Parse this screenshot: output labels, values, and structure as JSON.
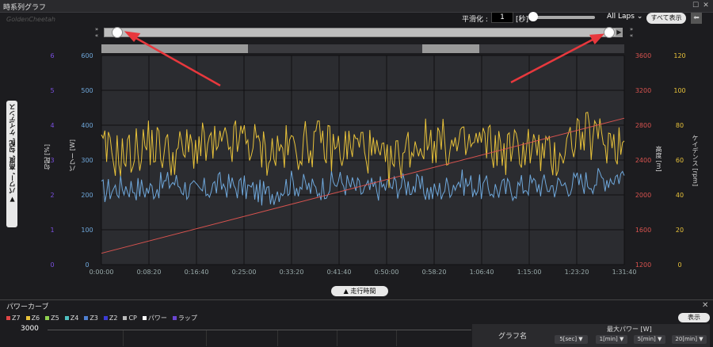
{
  "window": {
    "title": "時系列グラフ"
  },
  "controls": {
    "smoothing_label": "平滑化 :",
    "smoothing_value": "1",
    "smoothing_unit": "[秒]",
    "laps_select": "All Laps",
    "show_all_button": "すべて表示"
  },
  "side_tab": {
    "label": "▼ パワー, 高度, 勾配, ケイデンス"
  },
  "bottom_button": {
    "label": "▲ 走行時間"
  },
  "power_curve": {
    "title": "パワーカーブ",
    "legend": [
      {
        "label": "Z7",
        "color": "#e04545"
      },
      {
        "label": "Z6",
        "color": "#e8c23a"
      },
      {
        "label": "Z5",
        "color": "#8fd14f"
      },
      {
        "label": "Z4",
        "color": "#4fc0c0"
      },
      {
        "label": "Z3",
        "color": "#4f7fd1"
      },
      {
        "label": "Z2",
        "color": "#3b3bd6"
      },
      {
        "label": "CP",
        "color": "#bbbbbb"
      },
      {
        "label": "パワー",
        "color": "#ffffff"
      },
      {
        "label": "ラップ",
        "color": "#6a45d1"
      }
    ],
    "show_button": "表示",
    "y_value": "3000",
    "graph_name_header": "グラフ名",
    "max_power_header": "最大パワー [W]",
    "durations": [
      "5[sec] ▼",
      "1[min] ▼",
      "5[min] ▼",
      "20[min] ▼"
    ]
  },
  "chart_data": {
    "type": "line",
    "x_ticks": [
      "0:00:00",
      "0:08:20",
      "0:16:40",
      "0:25:00",
      "0:33:20",
      "0:41:40",
      "0:50:00",
      "0:58:20",
      "1:06:40",
      "1:15:00",
      "1:23:20",
      "1:31:40"
    ],
    "x_range_seconds": [
      0,
      5500
    ],
    "axes": {
      "slope": {
        "label": "勾配 [%]",
        "ticks": [
          "6",
          "5",
          "4",
          "3",
          "2",
          "1",
          "0"
        ],
        "range": [
          0,
          6
        ],
        "color": "#7a4fe0"
      },
      "power": {
        "label": "パワー [W]",
        "ticks": [
          "600",
          "500",
          "400",
          "300",
          "200",
          "100",
          "0"
        ],
        "range": [
          0,
          600
        ],
        "color": "#6fa8dc"
      },
      "altitude": {
        "label": "高度 [m]",
        "ticks": [
          "3600",
          "3200",
          "2800",
          "2400",
          "2000",
          "1600",
          "1200"
        ],
        "range": [
          1200,
          3600
        ],
        "color": "#d9534f"
      },
      "cadence": {
        "label": "ケイデンス [rpm]",
        "ticks": [
          "120",
          "100",
          "80",
          "60",
          "40",
          "20",
          "0"
        ],
        "range": [
          0,
          120
        ],
        "color": "#e8c23a"
      }
    },
    "grid": true,
    "series": [
      {
        "axis": "power",
        "color": "#6fa8dc",
        "x": [
          0,
          250,
          500,
          750,
          1000,
          1250,
          1500,
          1750,
          2000,
          2250,
          2500,
          2750,
          3000,
          3250,
          3500,
          3750,
          4000,
          4250,
          4500,
          4750,
          5000,
          5250,
          5500
        ],
        "y": [
          210,
          225,
          215,
          240,
          205,
          230,
          220,
          200,
          235,
          215,
          240,
          210,
          225,
          230,
          205,
          240,
          220,
          215,
          230,
          225,
          235,
          245,
          260
        ]
      },
      {
        "axis": "cadence",
        "color": "#e8c23a",
        "x": [
          0,
          250,
          500,
          750,
          1000,
          1250,
          1500,
          1750,
          2000,
          2250,
          2500,
          2750,
          3000,
          3250,
          3500,
          3750,
          4000,
          4250,
          4500,
          4750,
          5000,
          5250,
          5500
        ],
        "y": [
          65,
          62,
          70,
          63,
          68,
          66,
          72,
          64,
          67,
          70,
          66,
          69,
          55,
          68,
          72,
          66,
          70,
          65,
          68,
          60,
          75,
          72,
          70
        ]
      },
      {
        "axis": "altitude",
        "color": "#d9534f",
        "x": [
          0,
          5500
        ],
        "y": [
          1330,
          2880
        ]
      }
    ]
  }
}
